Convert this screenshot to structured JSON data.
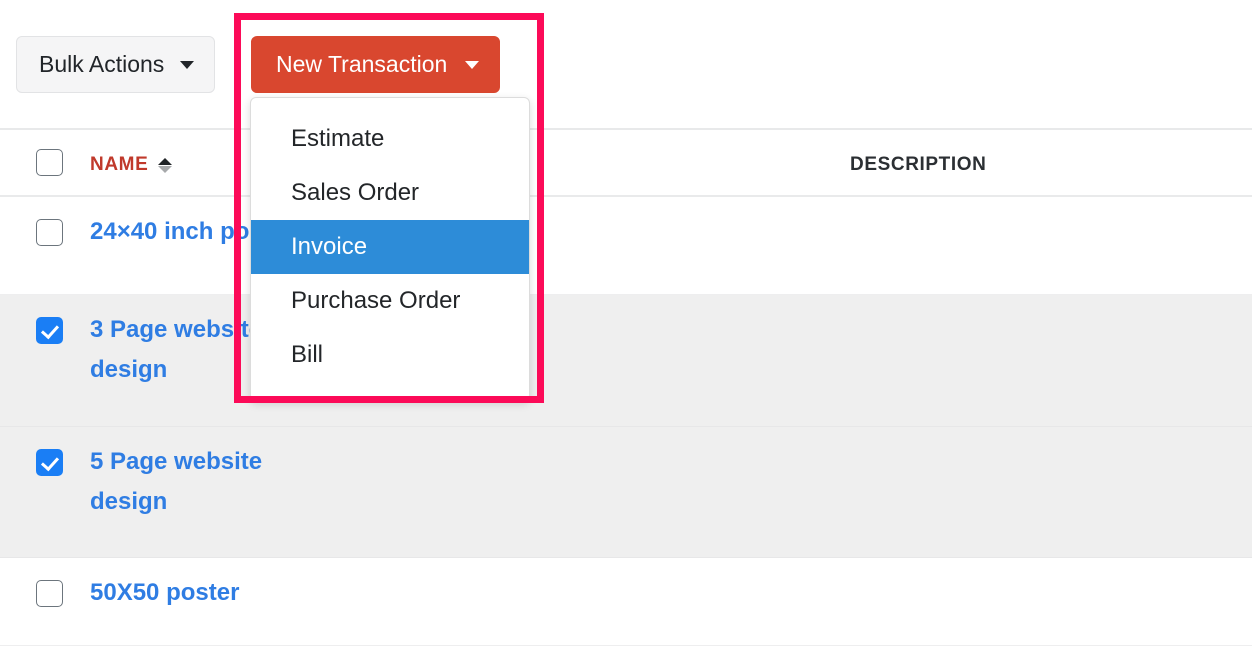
{
  "toolbar": {
    "bulk_actions_label": "Bulk Actions",
    "new_transaction_label": "New Transaction"
  },
  "menu": {
    "items": [
      {
        "label": "Estimate",
        "active": false
      },
      {
        "label": "Sales Order",
        "active": false
      },
      {
        "label": "Invoice",
        "active": true
      },
      {
        "label": "Purchase Order",
        "active": false
      },
      {
        "label": "Bill",
        "active": false
      }
    ]
  },
  "table": {
    "columns": [
      {
        "label": "NAME",
        "sorted": true
      },
      {
        "label": "DESCRIPTION",
        "sorted": false
      }
    ],
    "rows": [
      {
        "name": "24×40 inch poster",
        "checked": false,
        "striped": false,
        "description": ""
      },
      {
        "name": "3 Page website design",
        "checked": true,
        "striped": true,
        "description": ""
      },
      {
        "name": "5 Page website design",
        "checked": true,
        "striped": true,
        "description": ""
      },
      {
        "name": "50X50 poster",
        "checked": false,
        "striped": false,
        "description": ""
      }
    ]
  },
  "colors": {
    "primary_button": "#d9472f",
    "menu_highlight": "#2d8cd8",
    "link": "#2f7de3",
    "sorted_header": "#c0392b",
    "checkbox_checked": "#1a7ef5",
    "annotation": "#fc0a58",
    "striped_row": "#efefef"
  }
}
